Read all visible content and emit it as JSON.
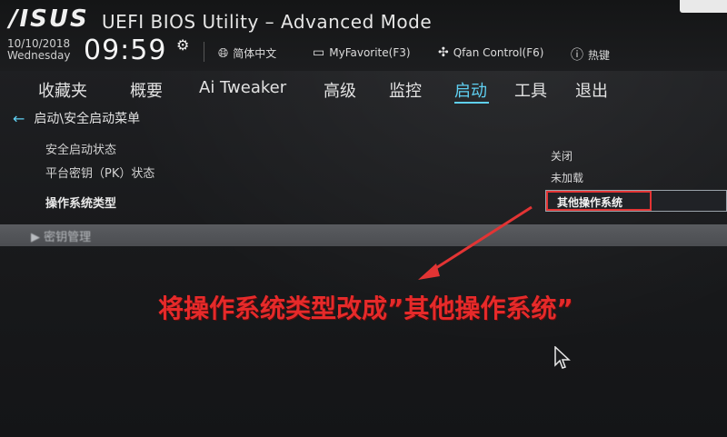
{
  "header": {
    "logo": "/ISUS",
    "title": "UEFI BIOS Utility – Advanced Mode",
    "date": "10/10/2018",
    "weekday": "Wednesday",
    "time": "09:59",
    "tools": [
      {
        "icon": "globe-icon",
        "label": "简体中文"
      },
      {
        "icon": "favorite-icon",
        "label": "MyFavorite(F3)"
      },
      {
        "icon": "fan-icon",
        "label": "Qfan Control(F6)"
      },
      {
        "icon": "help-icon",
        "label": "热键"
      }
    ]
  },
  "nav": {
    "tabs": [
      {
        "label": "收藏夹"
      },
      {
        "label": "概要"
      },
      {
        "label": "Ai Tweaker"
      },
      {
        "label": "高级"
      },
      {
        "label": "监控"
      },
      {
        "label": "启动"
      },
      {
        "label": "工具"
      },
      {
        "label": "退出"
      }
    ],
    "active": "启动"
  },
  "breadcrumb": "启动\\安全启动菜单",
  "settings": [
    {
      "label": "安全启动状态",
      "value": "关闭"
    },
    {
      "label": "平台密钥（PK）状态",
      "value": "未加载"
    },
    {
      "label": "操作系统类型",
      "value": "其他操作系统"
    }
  ],
  "section": "密钥管理",
  "annotation": "将操作系统类型改成”其他操作系统”",
  "colors": {
    "accent": "#5fd0f2",
    "highlight_border": "#e23434",
    "annotation": "#e62a2a"
  }
}
